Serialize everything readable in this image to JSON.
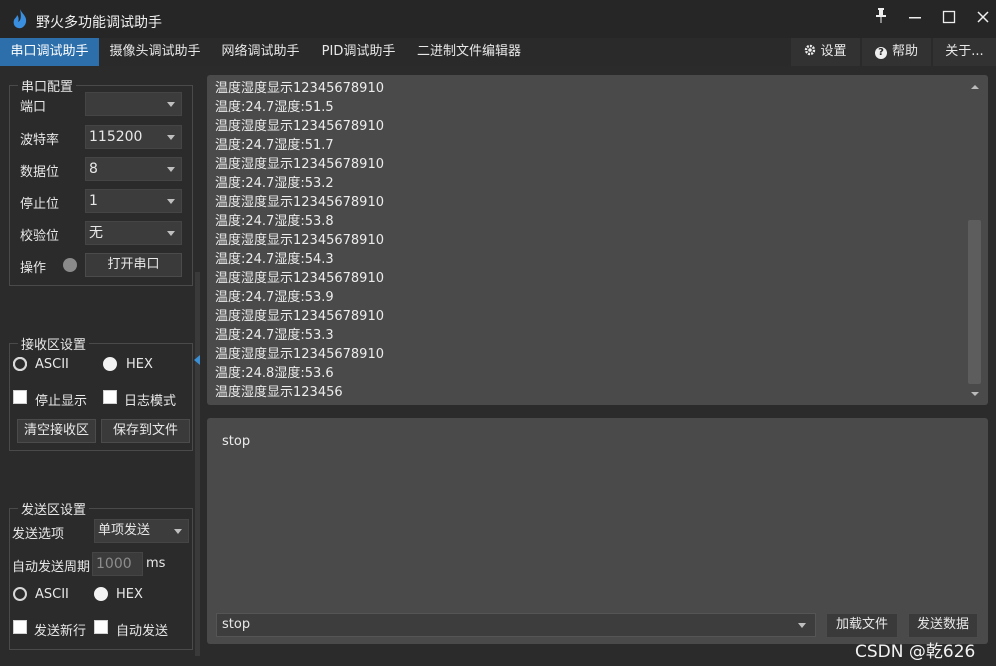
{
  "app": {
    "title": "野火多功能调试助手"
  },
  "tabs": [
    {
      "label": "串口调试助手"
    },
    {
      "label": "摄像头调试助手"
    },
    {
      "label": "网络调试助手"
    },
    {
      "label": "PID调试助手"
    },
    {
      "label": "二进制文件编辑器"
    }
  ],
  "right_tabs": {
    "settings": "设置",
    "help": "帮助",
    "about": "关于..."
  },
  "serial_config": {
    "title": "串口配置",
    "port_label": "端口",
    "port_value": "",
    "baud_label": "波特率",
    "baud_value": "115200",
    "databits_label": "数据位",
    "databits_value": "8",
    "stopbits_label": "停止位",
    "stopbits_value": "1",
    "parity_label": "校验位",
    "parity_value": "无",
    "op_label": "操作",
    "open_button": "打开串口"
  },
  "receive_settings": {
    "title": "接收区设置",
    "ascii": "ASCII",
    "hex": "HEX",
    "stop_display": "停止显示",
    "log_mode": "日志模式",
    "clear_button": "清空接收区",
    "save_button": "保存到文件"
  },
  "send_settings": {
    "title": "发送区设置",
    "option_label": "发送选项",
    "option_value": "单项发送",
    "period_label": "自动发送周期",
    "period_value": "1000",
    "period_unit": "ms",
    "ascii": "ASCII",
    "hex": "HEX",
    "newline": "发送新行",
    "auto_send": "自动发送"
  },
  "receive_lines": [
    "温度湿度显示12345678910",
    "温度:24.7湿度:51.5",
    "温度湿度显示12345678910",
    "温度:24.7湿度:51.7",
    "温度湿度显示12345678910",
    "温度:24.7湿度:53.2",
    "温度湿度显示12345678910",
    "温度:24.7湿度:53.8",
    "温度湿度显示12345678910",
    "温度:24.7湿度:54.3",
    "温度湿度显示12345678910",
    "温度:24.7湿度:53.9",
    "温度湿度显示12345678910",
    "温度:24.7湿度:53.3",
    "温度湿度显示12345678910",
    "温度:24.8湿度:53.6",
    "温度湿度显示123456"
  ],
  "send_area": {
    "text": "stop"
  },
  "send_bar": {
    "value": "stop",
    "load_button": "加载文件",
    "send_button": "发送数据"
  },
  "watermark": "CSDN @乾626",
  "colors": {
    "accent": "#2d6fab",
    "window_bg": "#2b2b2b",
    "text_area": "#4a4a4a"
  }
}
